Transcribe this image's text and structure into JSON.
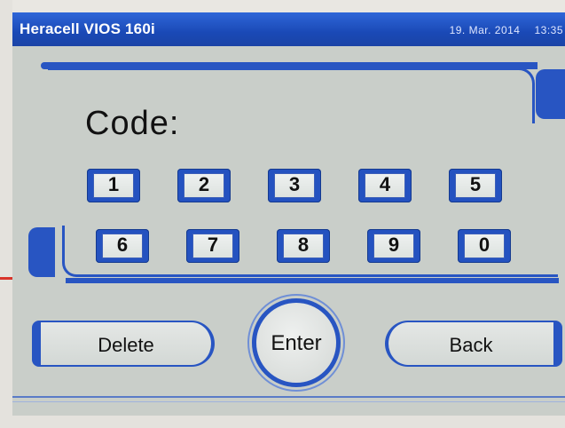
{
  "header": {
    "title": "Heracell VIOS 160i",
    "date": "19. Mar. 2014",
    "time": "13:35"
  },
  "code_label": "Code:",
  "keypad": {
    "keys": [
      "1",
      "2",
      "3",
      "4",
      "5",
      "6",
      "7",
      "8",
      "9",
      "0"
    ]
  },
  "actions": {
    "delete_label": "Delete",
    "enter_label": "Enter",
    "back_label": "Back"
  },
  "colors": {
    "accent_blue": "#2855c2",
    "title_bar": "#1a49b6",
    "screen_bg": "#c9cec9"
  }
}
